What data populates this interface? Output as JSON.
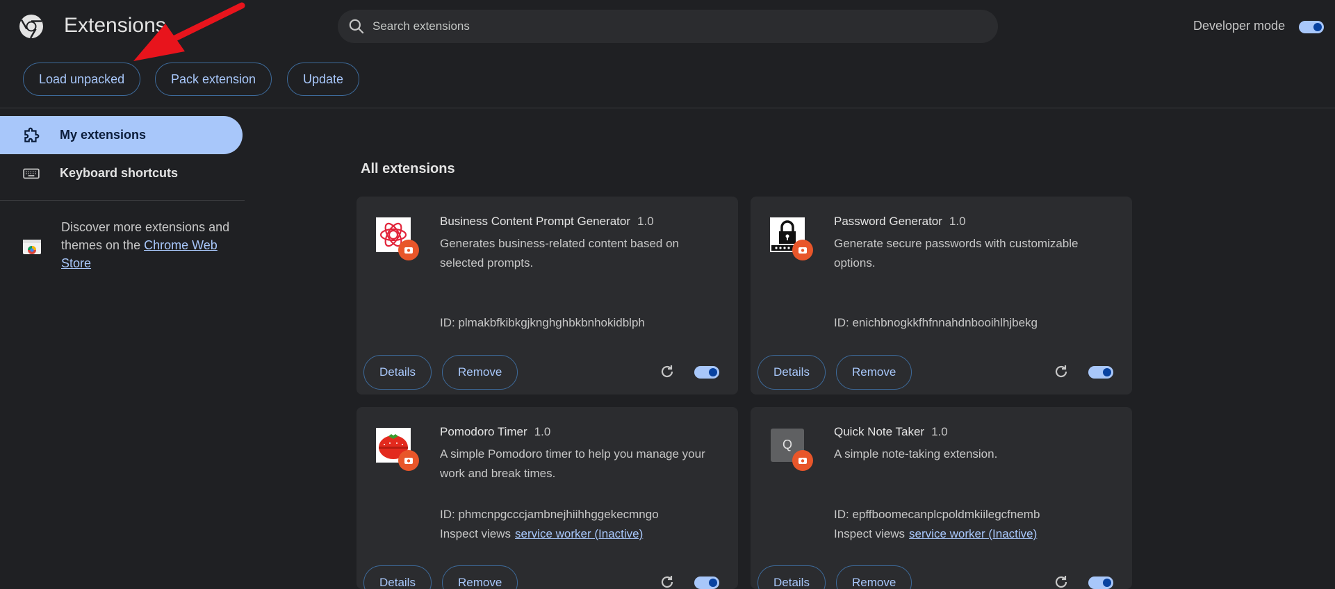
{
  "header": {
    "title": "Extensions",
    "search_placeholder": "Search extensions",
    "developer_mode_label": "Developer mode",
    "developer_mode_on": true
  },
  "toolbar": {
    "load_unpacked": "Load unpacked",
    "pack_extension": "Pack extension",
    "update": "Update"
  },
  "sidebar": {
    "items": [
      {
        "label": "My extensions",
        "icon": "puzzle-icon",
        "active": true
      },
      {
        "label": "Keyboard shortcuts",
        "icon": "keyboard-icon",
        "active": false
      }
    ],
    "discover_text": "Discover more extensions and themes on the",
    "discover_link": "Chrome Web Store"
  },
  "main": {
    "section_title": "All extensions",
    "extensions": [
      {
        "name": "Business Content Prompt Generator",
        "version": "1.0",
        "description": "Generates business-related content based on selected prompts.",
        "id_text": "ID: plmakbfkibkgjknghghbkbnhokidblph",
        "inspect_label": "",
        "inspect_link": "",
        "enabled": true,
        "details_label": "Details",
        "remove_label": "Remove"
      },
      {
        "name": "Password Generator",
        "version": "1.0",
        "description": "Generate secure passwords with customizable options.",
        "id_text": "ID: enichbnogkkfhfnnahdnbooihlhjbekg",
        "inspect_label": "",
        "inspect_link": "",
        "enabled": true,
        "details_label": "Details",
        "remove_label": "Remove"
      },
      {
        "name": "Pomodoro Timer",
        "version": "1.0",
        "description": "A simple Pomodoro timer to help you manage your work and break times.",
        "id_text": "ID: phmcnpgcccjambnejhiihhggekecmngo",
        "inspect_label": "Inspect views",
        "inspect_link": "service worker (Inactive)",
        "enabled": true,
        "details_label": "Details",
        "remove_label": "Remove"
      },
      {
        "name": "Quick Note Taker",
        "version": "1.0",
        "description": "A simple note-taking extension.",
        "id_text": "ID: epffboomecanplcpoldmkiilegcfnemb",
        "inspect_label": "Inspect views",
        "inspect_link": "service worker (Inactive)",
        "enabled": true,
        "details_label": "Details",
        "remove_label": "Remove",
        "icon_letter": "Q"
      }
    ]
  },
  "colors": {
    "background": "#1f2023",
    "card": "#2b2c2f",
    "accent": "#a8c7fa",
    "badge": "#e8562a",
    "annotation_arrow": "#e8141c"
  }
}
